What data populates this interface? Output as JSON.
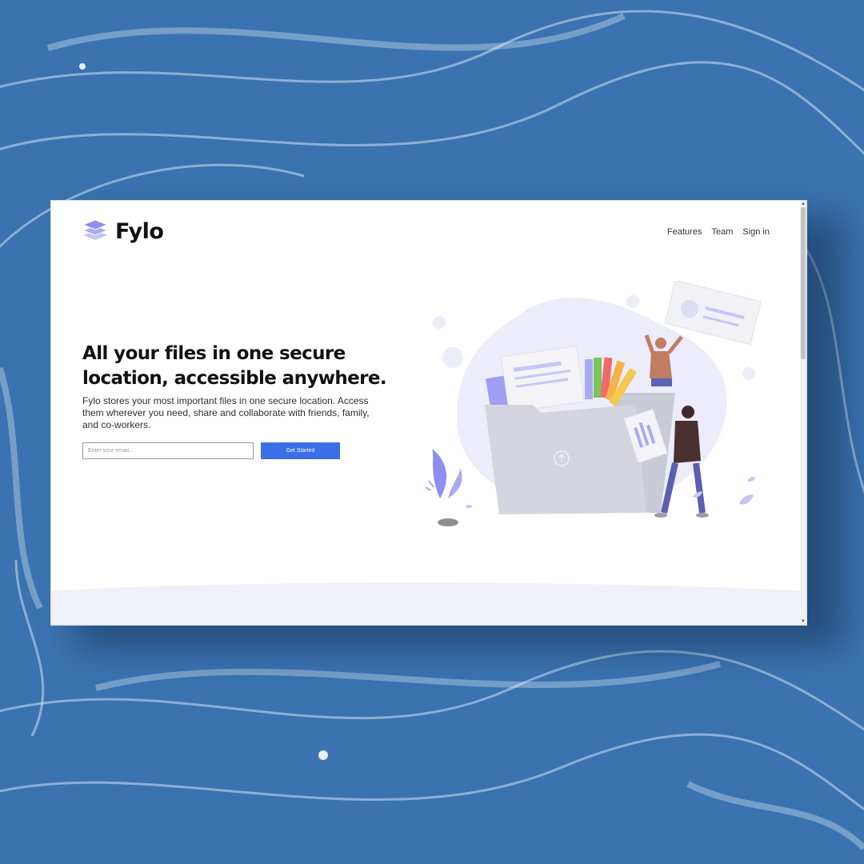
{
  "brand": {
    "name": "Fylo"
  },
  "nav": {
    "items": [
      {
        "label": "Features"
      },
      {
        "label": "Team"
      },
      {
        "label": "Sign in"
      }
    ]
  },
  "hero": {
    "title": "All your files in one secure location, accessible anywhere.",
    "description": "Fylo stores your most important files in one secure location. Access them wherever you need, share and collaborate with friends, family, and co-workers.",
    "email_placeholder": "Enter your email...",
    "cta_label": "Get Started"
  },
  "colors": {
    "accent": "#3a6fe8",
    "backdrop": "#3a73b0",
    "illustration_blob": "#ececfa",
    "logo_icon": "#8c8ef0"
  },
  "icons": [
    "fylo-logo-icon",
    "upload-arrow-icon"
  ]
}
